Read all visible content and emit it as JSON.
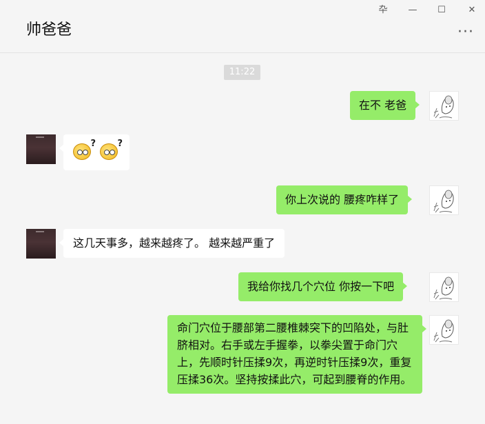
{
  "window": {
    "title": "帅爸爸",
    "controls": {
      "pin": "卆",
      "minimize": "—",
      "maximize": "☐",
      "close": "✕"
    },
    "more": "···"
  },
  "chat": {
    "timestamp": "11:22",
    "messages": [
      {
        "side": "me",
        "text": "在不 老爸"
      },
      {
        "side": "them",
        "type": "emoji",
        "emoji": [
          "confused-face-emoji",
          "confused-face-emoji"
        ]
      },
      {
        "side": "me",
        "text": "你上次说的 腰疼咋样了"
      },
      {
        "side": "them",
        "text": "这几天事多，越来越疼了。 越来越严重了"
      },
      {
        "side": "me",
        "text": "我给你找几个穴位 你按一下吧"
      },
      {
        "side": "me",
        "text": "命门穴位于腰部第二腰椎棘突下的凹陷处，与肚脐相对。右手或左手握拳，以拳尖置于命门穴上，先顺时针压揉9次，再逆时针压揉9次，重复压揉36次。坚持按揉此穴，可起到腰脊的作用。"
      }
    ]
  },
  "colors": {
    "me_bubble": "#95ec69",
    "them_bubble": "#ffffff",
    "background": "#f5f5f5",
    "timestamp_badge": "#dadada"
  }
}
